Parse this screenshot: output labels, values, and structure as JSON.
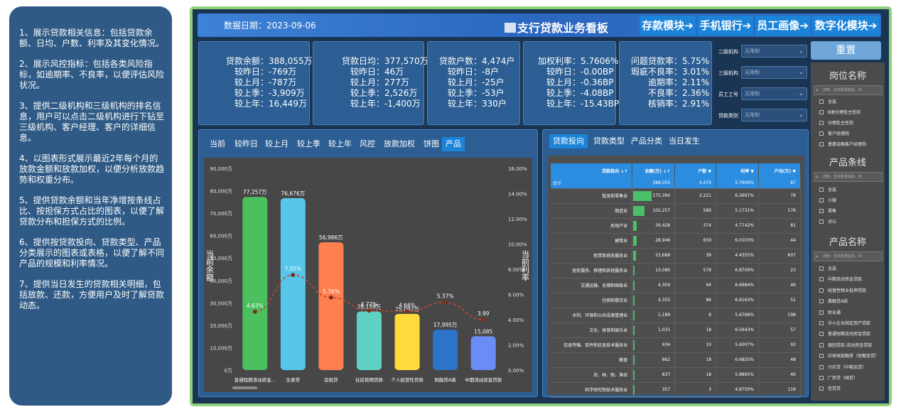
{
  "notes": [
    "1、展示贷款相关信息：包括贷款余额、日均、户数、利率及其变化情况。",
    "2、展示风控指标：包括各类风险指标，如逾期率、不良率，以便评估风险状况。",
    "3、提供二级机构和三级机构的排名信息，用户可以点击二级机构进行下钻至三级机构、客户经理、客户的详细信息。",
    "4、以图表形式展示最近2年每个月的放款金额和放款加权，以便分析放款趋势和权重分布。",
    "5、提供贷款余额和当年净增按条线占比、按担保方式占比的图表，以便了解贷款分布和担保方式的比例。",
    "6、提供按贷款投向、贷款类型、产品分类展示的图表或表格，以便了解不同产品的规模和利率情况。",
    "7、提供当日发生的贷款相关明细，包括放款、还款，方便用户及时了解贷款动态。"
  ],
  "header": {
    "date_label": "数据日期：2023-09-06",
    "title": "支行贷款业务看板",
    "nav": [
      "存款模块",
      "手机银行",
      "员工画像",
      "数字化模块"
    ],
    "nav_arrow": "➔"
  },
  "kpis": [
    {
      "rows": [
        [
          "贷款余额：",
          "388,055万"
        ],
        [
          "较昨日：",
          "-769万"
        ],
        [
          "较上月：",
          "-787万"
        ],
        [
          "较上季：",
          "-3,909万"
        ],
        [
          "较上年：",
          "16,449万"
        ]
      ]
    },
    {
      "rows": [
        [
          "贷款日均：",
          "377,570万"
        ],
        [
          "较昨日：",
          "46万"
        ],
        [
          "较上月：",
          "277万"
        ],
        [
          "较上季：",
          "2,526万"
        ],
        [
          "较上年：",
          "-1,400万"
        ]
      ]
    },
    {
      "rows": [
        [
          "贷款户数：",
          "4,474户"
        ],
        [
          "较昨日：",
          "-8户"
        ],
        [
          "较上月：",
          "-25户"
        ],
        [
          "较上季：",
          "-53户"
        ],
        [
          "较上年：",
          "330户"
        ]
      ]
    },
    {
      "rows": [
        [
          "加权利率：",
          "5.7606%"
        ],
        [
          "较昨日：",
          "-0.00BP"
        ],
        [
          "较上月：",
          "-0.36BP"
        ],
        [
          "较上季：",
          "-4.08BP"
        ],
        [
          "较上年：",
          "-15.43BP"
        ]
      ]
    },
    {
      "rows": [
        [
          "问题贷款率：",
          "5.75%"
        ],
        [
          "瑕疵不良率：",
          "3.01%"
        ],
        [
          "逾期率：",
          "2.11%"
        ],
        [
          "不良率：",
          "2.36%"
        ],
        [
          "核销率：",
          "2.91%"
        ]
      ]
    }
  ],
  "filters": [
    {
      "label": "二级机构",
      "value": "无限制"
    },
    {
      "label": "三级机构",
      "value": "无限制"
    },
    {
      "label": "员工工号",
      "value": "无限制"
    },
    {
      "label": "贷款类别",
      "value": "无限制"
    }
  ],
  "reset_label": "重置",
  "side_sections": [
    {
      "title": "岗位名称",
      "search": "搜索，支持批量粘贴、快",
      "options": [
        "全选",
        "B类分理处主任岗",
        "分理处主任岗",
        "客户经理岗",
        "普惠金融客户经理岗"
      ]
    },
    {
      "title": "产品条线",
      "search": "搜索，支持批量粘贴、快",
      "options": [
        "全选",
        "小微",
        "零售",
        "对公"
      ]
    },
    {
      "title": "产品名称",
      "search": "搜索，支持批量粘贴、快",
      "options": [
        "全选",
        "中期流动资金贷款",
        "经营性物业抵押贷款",
        "惠融贷A款",
        "助业通",
        "中小企业固定资产贷款",
        "普通短期流动资金贷款",
        "银团贷款-流动资金贷款",
        "应收账款融资（短期流贷）",
        "兴农贷（中期流贷）",
        "厂房贷（国贷）",
        "信贷贷"
      ]
    }
  ],
  "chart_tabs": [
    "当前",
    "较昨日",
    "较上月",
    "较上季",
    "较上年",
    "风控",
    "放款加权",
    "饼图",
    "产品"
  ],
  "chart_active_tab": 8,
  "chart_data": {
    "type": "bar",
    "categories": [
      "普通短期流动资金...",
      "生意贷",
      "房抵贷",
      "住房按揭贷款",
      "个人经营性贷款",
      "侧融贷A款",
      "中期流动资金贷款"
    ],
    "series": [
      {
        "type": "bar",
        "values": [
          77257,
          76676,
          56986,
          26159,
          25092,
          17995,
          15085
        ],
        "labels": [
          "77,257万",
          "76,676万",
          "56,986万",
          "26,159万",
          "25,092万",
          "17,995万",
          "15,085"
        ],
        "colors": [
          "#4cbf5f",
          "#56c6ea",
          "#ff7f50",
          "#5fd1c2",
          "#ffdc3c",
          "#2b74c9",
          "#6c8cf5"
        ]
      },
      {
        "type": "line",
        "values": [
          4.63,
          7.55,
          5.76,
          4.72,
          4.66,
          5.37,
          3.99
        ],
        "labels": [
          "4.63%",
          "7.55%",
          "5.76%",
          "4.72%",
          "4.66%",
          "5.37%",
          "3.99"
        ],
        "color": "#c0462f"
      }
    ],
    "ylabel": "当前余额",
    "y2label": "当前利率",
    "ylim": [
      0,
      90000
    ],
    "y2lim": [
      0,
      16
    ],
    "yticks": [
      "0万",
      "10,000万",
      "20,000万",
      "30,000万",
      "40,000万",
      "50,000万",
      "60,000万",
      "70,000万",
      "80,000万",
      "90,000万"
    ],
    "y2ticks": [
      "0.00%",
      "2.00%",
      "4.00%",
      "6.00%",
      "8.00%",
      "10.00%",
      "12.00%",
      "14.00%",
      "16.00%"
    ],
    "grid": false
  },
  "table_tabs": [
    "贷款投向",
    "贷款类型",
    "产品分类",
    "当日发生"
  ],
  "table_active_tab": 0,
  "table": {
    "headers": [
      "贷款投向 ↓↑",
      "余额(万) ↓↑",
      "户数 ▼",
      "利率 ▼",
      "户均(万) ▼"
    ],
    "total": [
      "合计",
      "388,055",
      "4,474",
      "5.7606%",
      "87"
    ],
    "max_amount": 388055,
    "rows": [
      {
        "name": "批发和零售业",
        "amount": "175,394",
        "amount_value": 175394,
        "count": "2,221",
        "rate": "6.2697%",
        "avg": "79"
      },
      {
        "name": "制造业",
        "amount": "102,257",
        "amount_value": 102257,
        "count": "580",
        "rate": "5.1731%",
        "avg": "176"
      },
      {
        "name": "房地产业",
        "amount": "30,428",
        "amount_value": 30428,
        "count": "374",
        "rate": "4.7742%",
        "avg": "81"
      },
      {
        "name": "建筑业",
        "amount": "28,946",
        "amount_value": 28946,
        "count": "659",
        "rate": "6.0103%",
        "avg": "44"
      },
      {
        "name": "租赁和商务服务业",
        "amount": "23,689",
        "amount_value": 23689,
        "count": "39",
        "rate": "4.4355%",
        "avg": "607"
      },
      {
        "name": "居民服务、修理和其他服务业",
        "amount": "13,080",
        "amount_value": 13080,
        "count": "579",
        "rate": "6.8709%",
        "avg": "23"
      },
      {
        "name": "交通运输、仓储和邮政业",
        "amount": "4,359",
        "amount_value": 4359,
        "count": "94",
        "rate": "6.6984%",
        "avg": "46"
      },
      {
        "name": "住宿和餐饮业",
        "amount": "4,355",
        "amount_value": 4355,
        "count": "86",
        "rate": "6.6163%",
        "avg": "51"
      },
      {
        "name": "水利、环境和公共设施管理业",
        "amount": "1,189",
        "amount_value": 1189,
        "count": "6",
        "rate": "5.6768%",
        "avg": "198"
      },
      {
        "name": "文化、体育和娱乐业",
        "amount": "1,031",
        "amount_value": 1031,
        "count": "18",
        "rate": "6.5943%",
        "avg": "57"
      },
      {
        "name": "信息传输、软件和信息技术服务业",
        "amount": "934",
        "amount_value": 934,
        "count": "10",
        "rate": "5.6007%",
        "avg": "93"
      },
      {
        "name": "教育",
        "amount": "862",
        "amount_value": 862,
        "count": "18",
        "rate": "6.6855%",
        "avg": "48"
      },
      {
        "name": "农、林、牧、渔业",
        "amount": "837",
        "amount_value": 837,
        "count": "18",
        "rate": "5.8895%",
        "avg": "46"
      },
      {
        "name": "科学研究和技术服务业",
        "amount": "357",
        "amount_value": 357,
        "count": "3",
        "rate": "4.8750%",
        "avg": "119"
      }
    ]
  }
}
